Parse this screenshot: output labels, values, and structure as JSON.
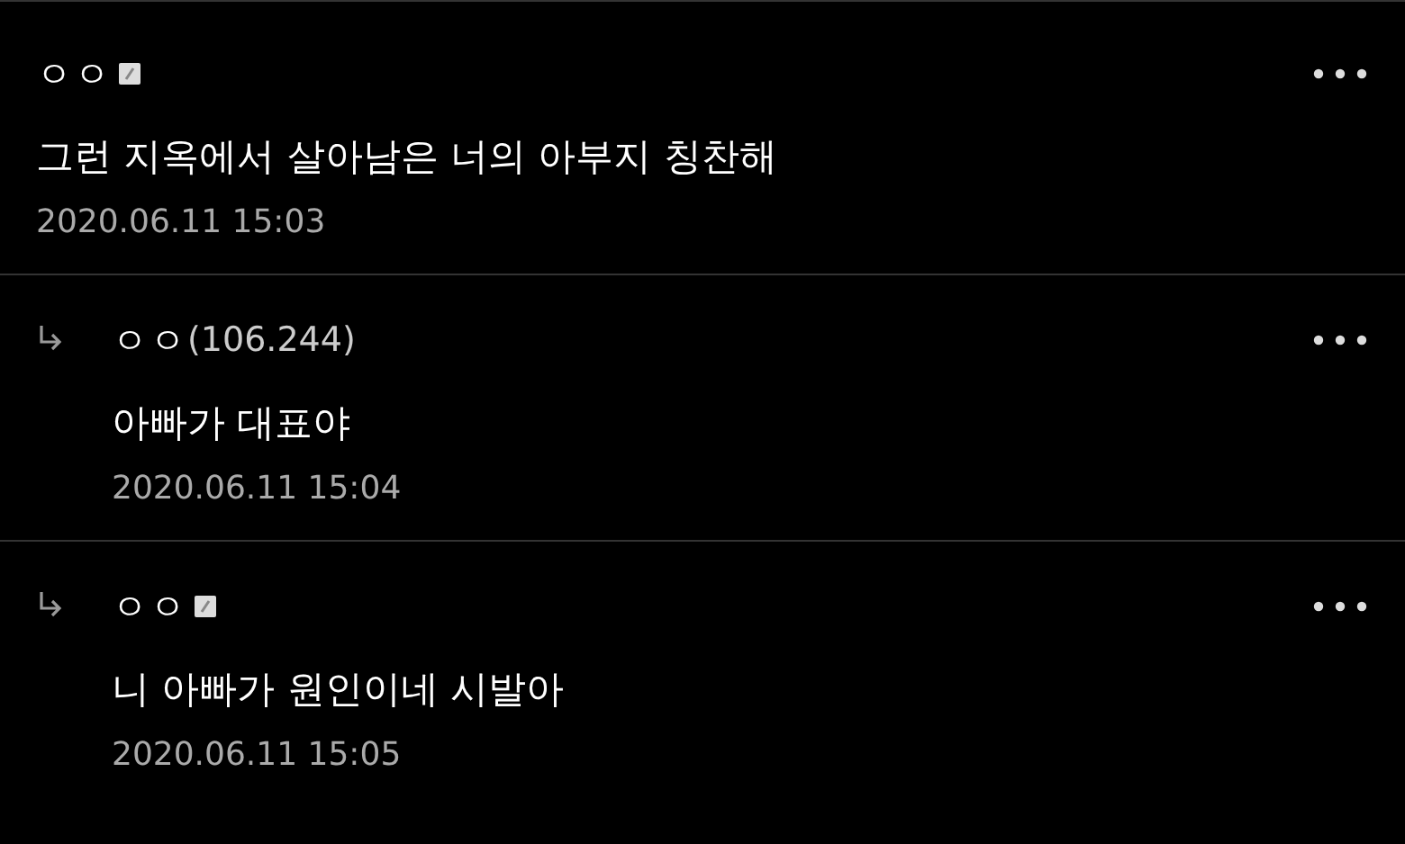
{
  "comments": [
    {
      "kind": "comment",
      "name": "ㅇㅇ",
      "badge": true,
      "text": "그런 지옥에서 살아남은 너의 아부지 칭찬해",
      "date": "2020.06.11 15:03"
    },
    {
      "kind": "reply",
      "name": "ㅇㅇ",
      "ip": "(106.244)",
      "badge": false,
      "text": "아빠가 대표야",
      "date": "2020.06.11 15:04"
    },
    {
      "kind": "reply",
      "name": "ㅇㅇ",
      "badge": true,
      "text": "니 아빠가 원인이네 시발아",
      "date": "2020.06.11 15:05"
    }
  ]
}
